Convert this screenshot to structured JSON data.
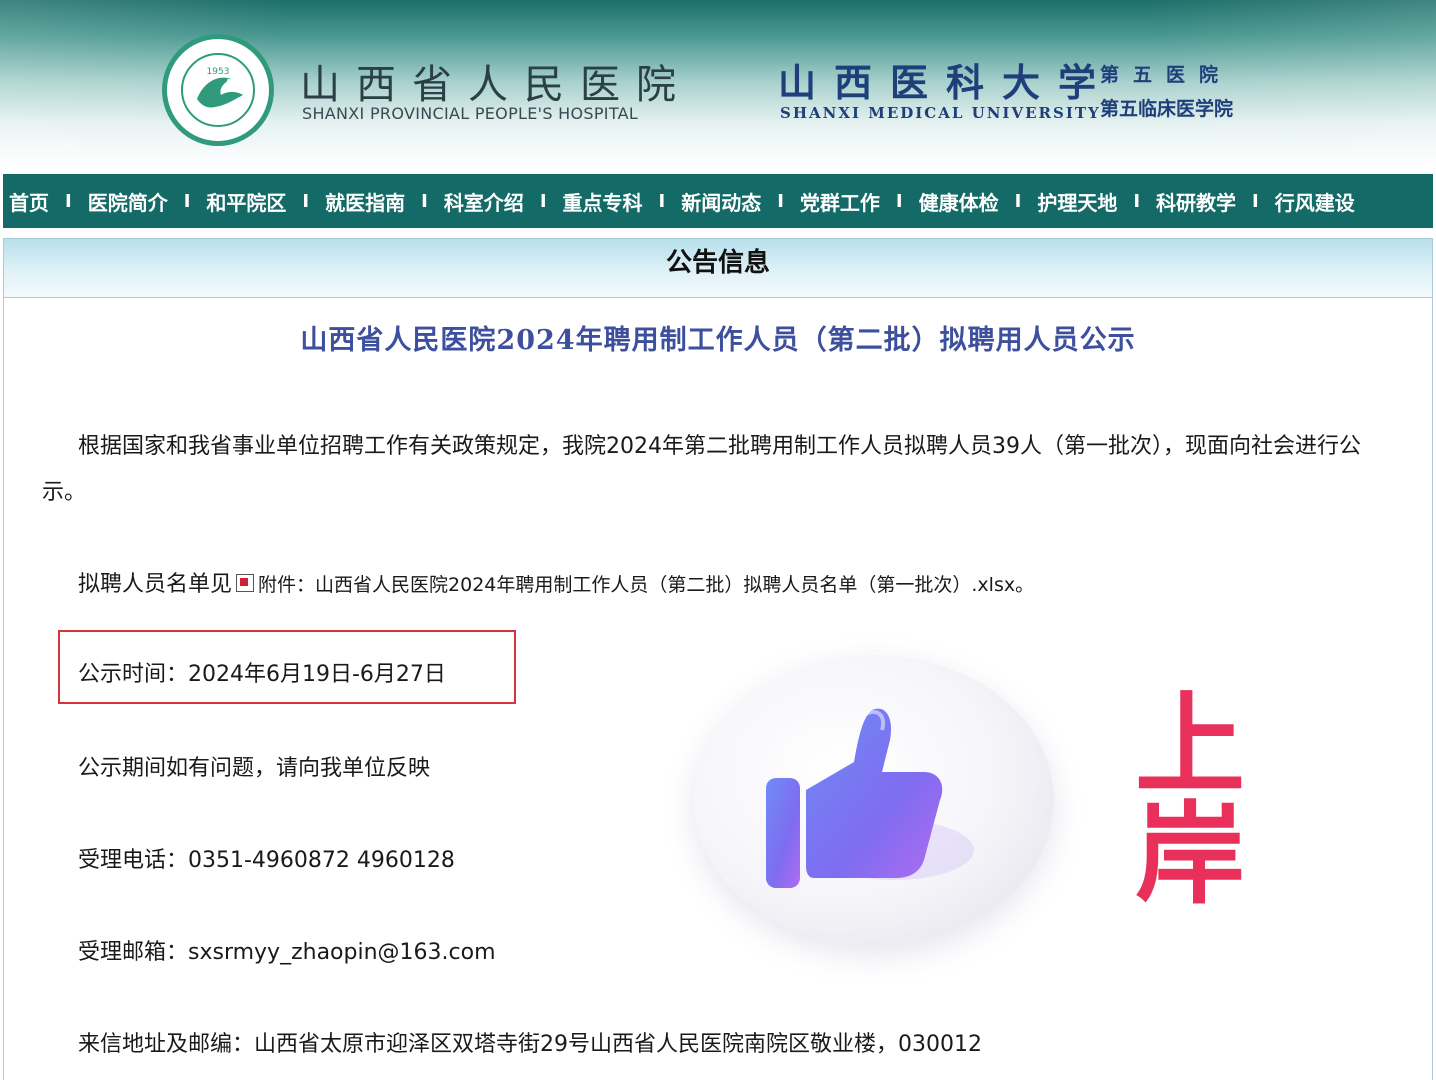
{
  "header": {
    "hospital_cn": "山西省人民医院",
    "hospital_en": "SHANXI PROVINCIAL PEOPLE'S HOSPITAL",
    "logo_year": "1953",
    "university_cn": "山西医科大学",
    "university_en": "SHANXI  MEDICAL UNIVERSITY",
    "university_sub1": "第五医院",
    "university_sub2": "第五临床医学院"
  },
  "nav": {
    "items": [
      "首页",
      "医院简介",
      "和平院区",
      "就医指南",
      "科室介绍",
      "重点专科",
      "新闻动态",
      "党群工作",
      "健康体检",
      "护理天地",
      "科研教学",
      "行风建设"
    ],
    "separator": "I"
  },
  "section_title": "公告信息",
  "article": {
    "title": "山西省人民医院2024年聘用制工作人员（第二批）拟聘用人员公示",
    "intro": "根据国家和我省事业单位招聘工作有关政策规定，我院2024年第二批聘用制工作人员拟聘人员39人（第一批次），现面向社会进行公示。",
    "attachment_prefix": "拟聘人员名单见",
    "attachment_label": "附件：",
    "attachment_name": "山西省人民医院2024年聘用制工作人员（第二批）拟聘人员名单（第一批次）.xlsx。",
    "period": "公示时间：2024年6月19日-6月27日",
    "feedback": "公示期间如有问题，请向我单位反映",
    "phone": "受理电话：0351-4960872 4960128",
    "email": "受理邮箱：sxsrmyy_zhaopin@163.com",
    "address": "来信地址及邮编：山西省太原市迎泽区双塔寺街29号山西省人民医院南院区敬业楼，030012"
  },
  "overlay": {
    "sticker_text": "上岸",
    "sticker_color": "#e8305a"
  },
  "colors": {
    "nav_bg": "#136a66",
    "title": "#3d4f9d",
    "highlight_border": "#d4343c"
  }
}
